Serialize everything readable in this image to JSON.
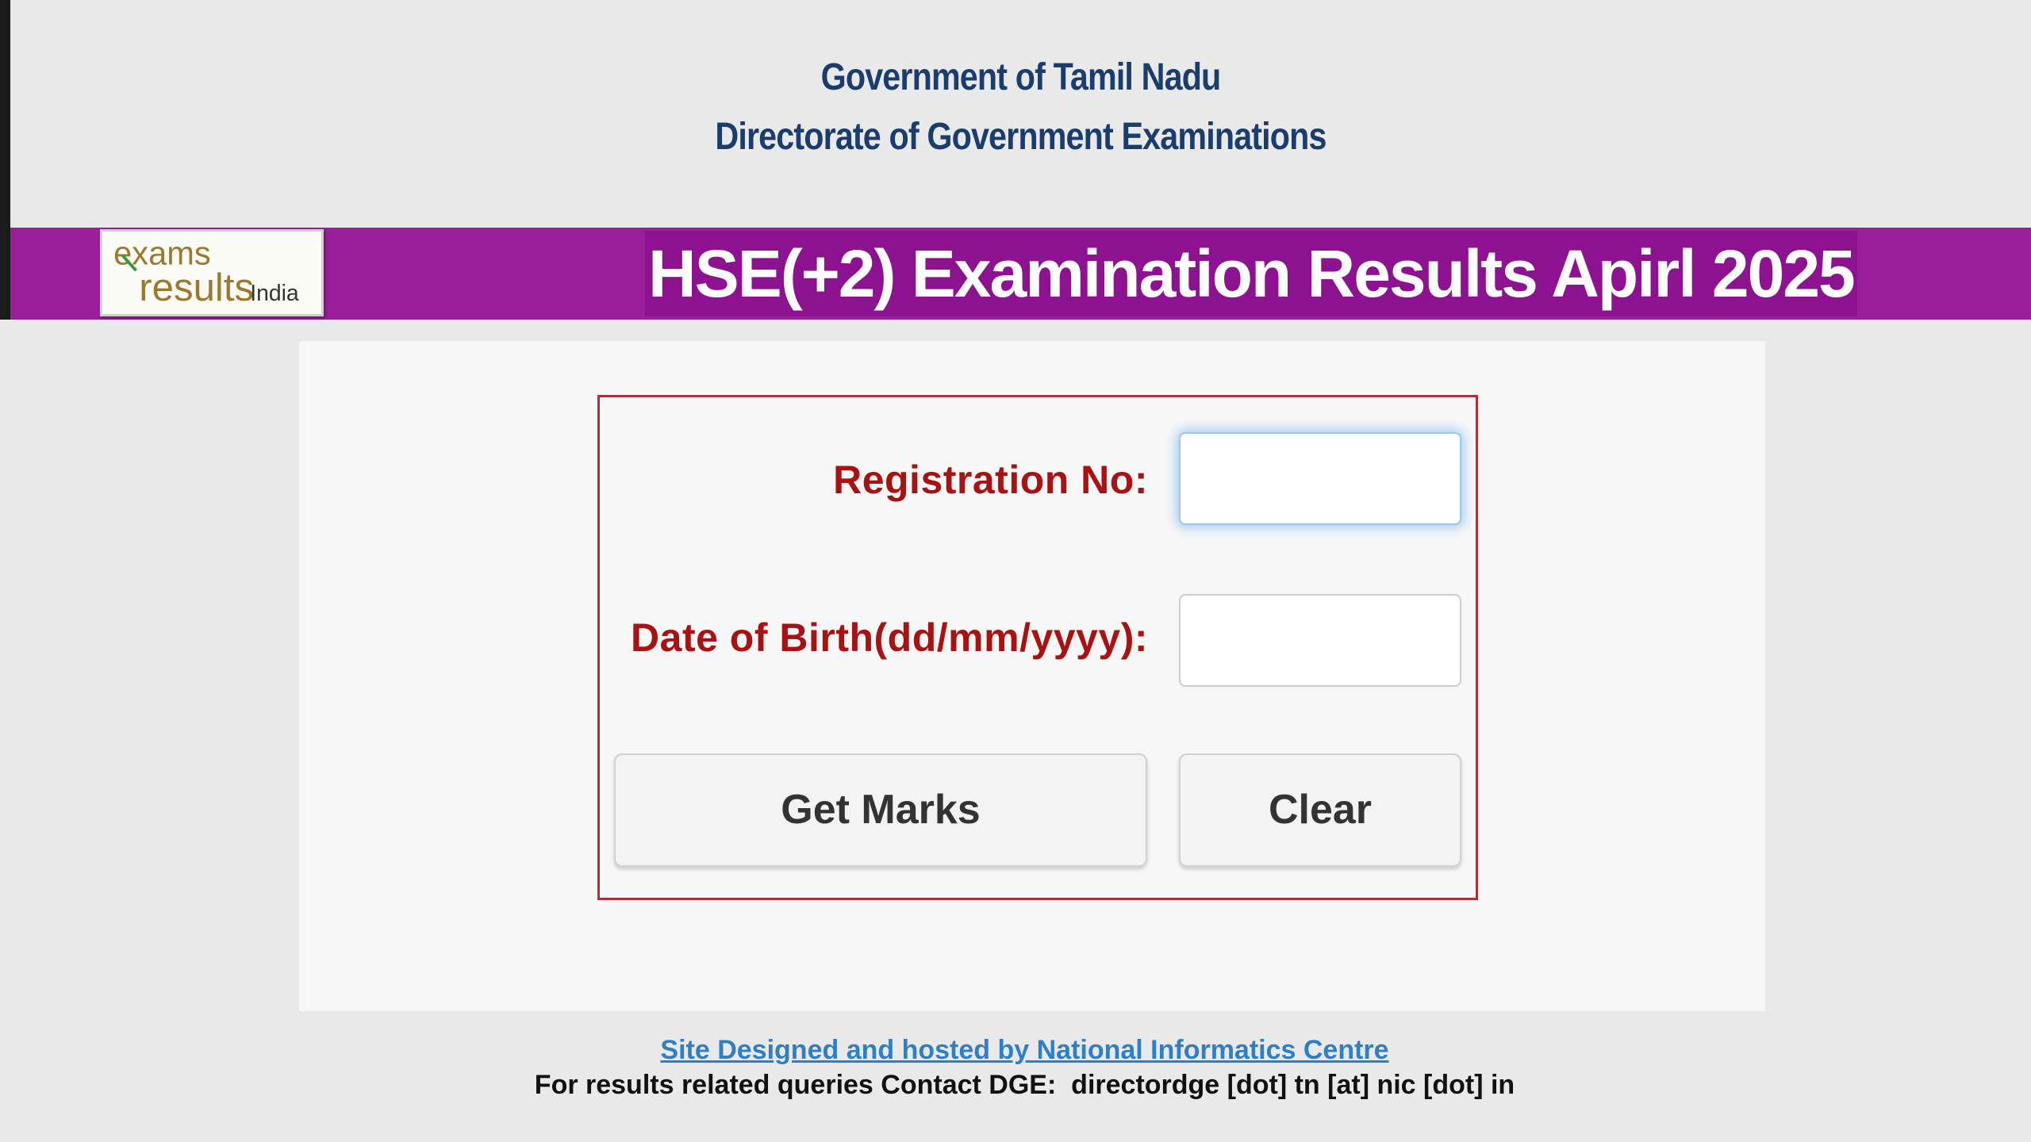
{
  "header": {
    "line1": "Government of Tamil Nadu",
    "line2": "Directorate of Government Examinations"
  },
  "banner": {
    "title": "HSE(+2) Examination Results Apirl 2025",
    "logo": {
      "word1": "exams",
      "word2": "results",
      "word3": "India"
    }
  },
  "form": {
    "registration_label": "Registration No:",
    "registration_value": "",
    "dob_label": "Date of Birth(dd/mm/yyyy):",
    "dob_value": "",
    "get_marks_label": "Get Marks",
    "clear_label": "Clear"
  },
  "footer": {
    "link_text": "Site Designed and hosted by National Informatics Centre",
    "contact_text": "For results related queries Contact DGE:  directordge [dot] tn [at] nic [dot] in"
  },
  "colors": {
    "banner_purple": "#9b1f9b",
    "title_bg": "#8d1290",
    "header_blue": "#1a3d6d",
    "label_red": "#a81212",
    "form_border": "#a8323a",
    "link_blue": "#2f7fc7"
  }
}
